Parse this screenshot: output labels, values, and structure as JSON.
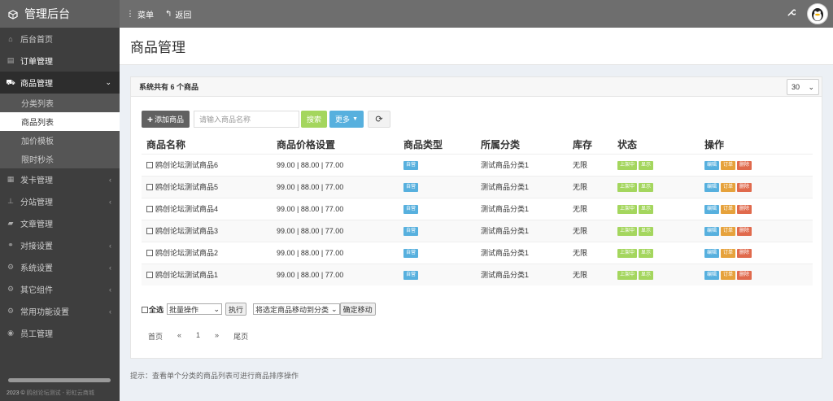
{
  "app": {
    "title": "管理后台",
    "menu_label": "菜单",
    "back_label": "返回"
  },
  "sidebar": {
    "items": [
      {
        "label": "后台首页",
        "icon": "home-icon"
      },
      {
        "label": "订单管理",
        "icon": "list-icon"
      },
      {
        "label": "商品管理",
        "icon": "cart-icon"
      },
      {
        "label": "发卡管理",
        "icon": "grid-icon"
      },
      {
        "label": "分站管理",
        "icon": "sitemap-icon"
      },
      {
        "label": "文章管理",
        "icon": "book-icon"
      },
      {
        "label": "对接设置",
        "icon": "connect-icon"
      },
      {
        "label": "系统设置",
        "icon": "gear-icon"
      },
      {
        "label": "其它组件",
        "icon": "gears-icon"
      },
      {
        "label": "常用功能设置",
        "icon": "gears-icon"
      },
      {
        "label": "员工管理",
        "icon": "user-icon"
      }
    ],
    "submenu": [
      "分类列表",
      "商品列表",
      "加价模板",
      "限时秒杀"
    ],
    "footer": {
      "year": "2023",
      "site": "鸥创论坛测试 - 彩虹云商城"
    }
  },
  "page": {
    "title": "商品管理",
    "panel_title": "系统共有 6 个商品",
    "page_size": "30"
  },
  "toolbar": {
    "add_label": "添加商品",
    "search_placeholder": "请输入商品名称",
    "search_label": "搜索",
    "more_label": "更多"
  },
  "table": {
    "headers": [
      "商品名称",
      "商品价格设置",
      "商品类型",
      "所属分类",
      "库存",
      "状态",
      "操作"
    ],
    "rows": [
      {
        "name": "鸥创论坛测试商品6",
        "price": "99.00 | 88.00 | 77.00",
        "type": "自营",
        "category": "测试商品分类1",
        "stock": "无限"
      },
      {
        "name": "鸥创论坛测试商品5",
        "price": "99.00 | 88.00 | 77.00",
        "type": "自营",
        "category": "测试商品分类1",
        "stock": "无限"
      },
      {
        "name": "鸥创论坛测试商品4",
        "price": "99.00 | 88.00 | 77.00",
        "type": "自营",
        "category": "测试商品分类1",
        "stock": "无限"
      },
      {
        "name": "鸥创论坛测试商品3",
        "price": "99.00 | 88.00 | 77.00",
        "type": "自营",
        "category": "测试商品分类1",
        "stock": "无限"
      },
      {
        "name": "鸥创论坛测试商品2",
        "price": "99.00 | 88.00 | 77.00",
        "type": "自营",
        "category": "测试商品分类1",
        "stock": "无限"
      },
      {
        "name": "鸥创论坛测试商品1",
        "price": "99.00 | 88.00 | 77.00",
        "type": "自营",
        "category": "测试商品分类1",
        "stock": "无限"
      }
    ],
    "status_on_label": "上架中",
    "status_show_label": "显示",
    "action_edit": "编辑",
    "action_order": "订单",
    "action_delete": "删除"
  },
  "batch": {
    "select_all": "全选",
    "batch_select": "批量操作",
    "execute": "执行",
    "move_select": "将选定商品移动到分类",
    "confirm_move": "确定移动"
  },
  "pager": {
    "first": "首页",
    "prev": "«",
    "current": "1",
    "next": "»",
    "last": "尾页"
  },
  "tip": "提示：查看单个分类的商品列表可进行商品排序操作",
  "colors": {
    "accent_green": "#a4d65e",
    "accent_blue": "#57b0de",
    "orange": "#e6a23c",
    "red": "#e06a4d"
  }
}
